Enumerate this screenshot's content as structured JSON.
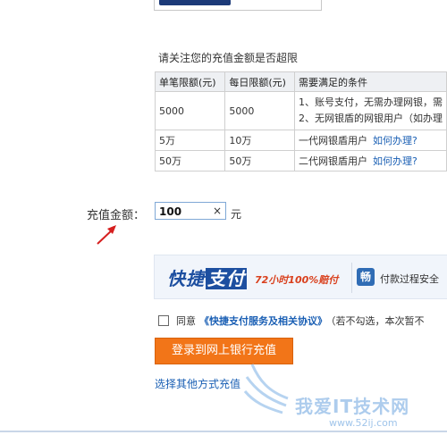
{
  "notice": "请关注您的充值金额是否超限",
  "limits_table": {
    "headers": [
      "单笔限额(元)",
      "每日限额(元)",
      "需要满足的条件"
    ],
    "rows": [
      {
        "single": "5000",
        "daily": "5000",
        "cond1": "1、账号支付，无需办理网银，需",
        "cond2": "2、无网银盾的网银用户（如办理",
        "link": ""
      },
      {
        "single": "5万",
        "daily": "10万",
        "cond1": "一代网银盾用户",
        "link": "如何办理?"
      },
      {
        "single": "50万",
        "daily": "50万",
        "cond1": "二代网银盾用户",
        "link": "如何办理?"
      }
    ]
  },
  "amount": {
    "label": "充值金额：",
    "value": "100",
    "clear_glyph": "×",
    "unit": "元"
  },
  "banner": {
    "quick": "快捷",
    "pay": "支付",
    "slogan": "72小时100%赔付",
    "seal_glyph": "畅",
    "secure": "付款过程安全"
  },
  "agreement": {
    "prefix": "同意",
    "link": "《快捷支付服务及相关协议》",
    "note": "（若不勾选，本次暂不"
  },
  "login_button": "登录到网上银行充值",
  "other_link": "选择其他方式充值",
  "watermark": {
    "text": "我爱IT技术网",
    "url": "www.52ij.com"
  },
  "colors": {
    "accent": "#f27518",
    "link": "#1a5fb4",
    "brand": "#1d4fa0",
    "slogan": "#d9401d"
  }
}
